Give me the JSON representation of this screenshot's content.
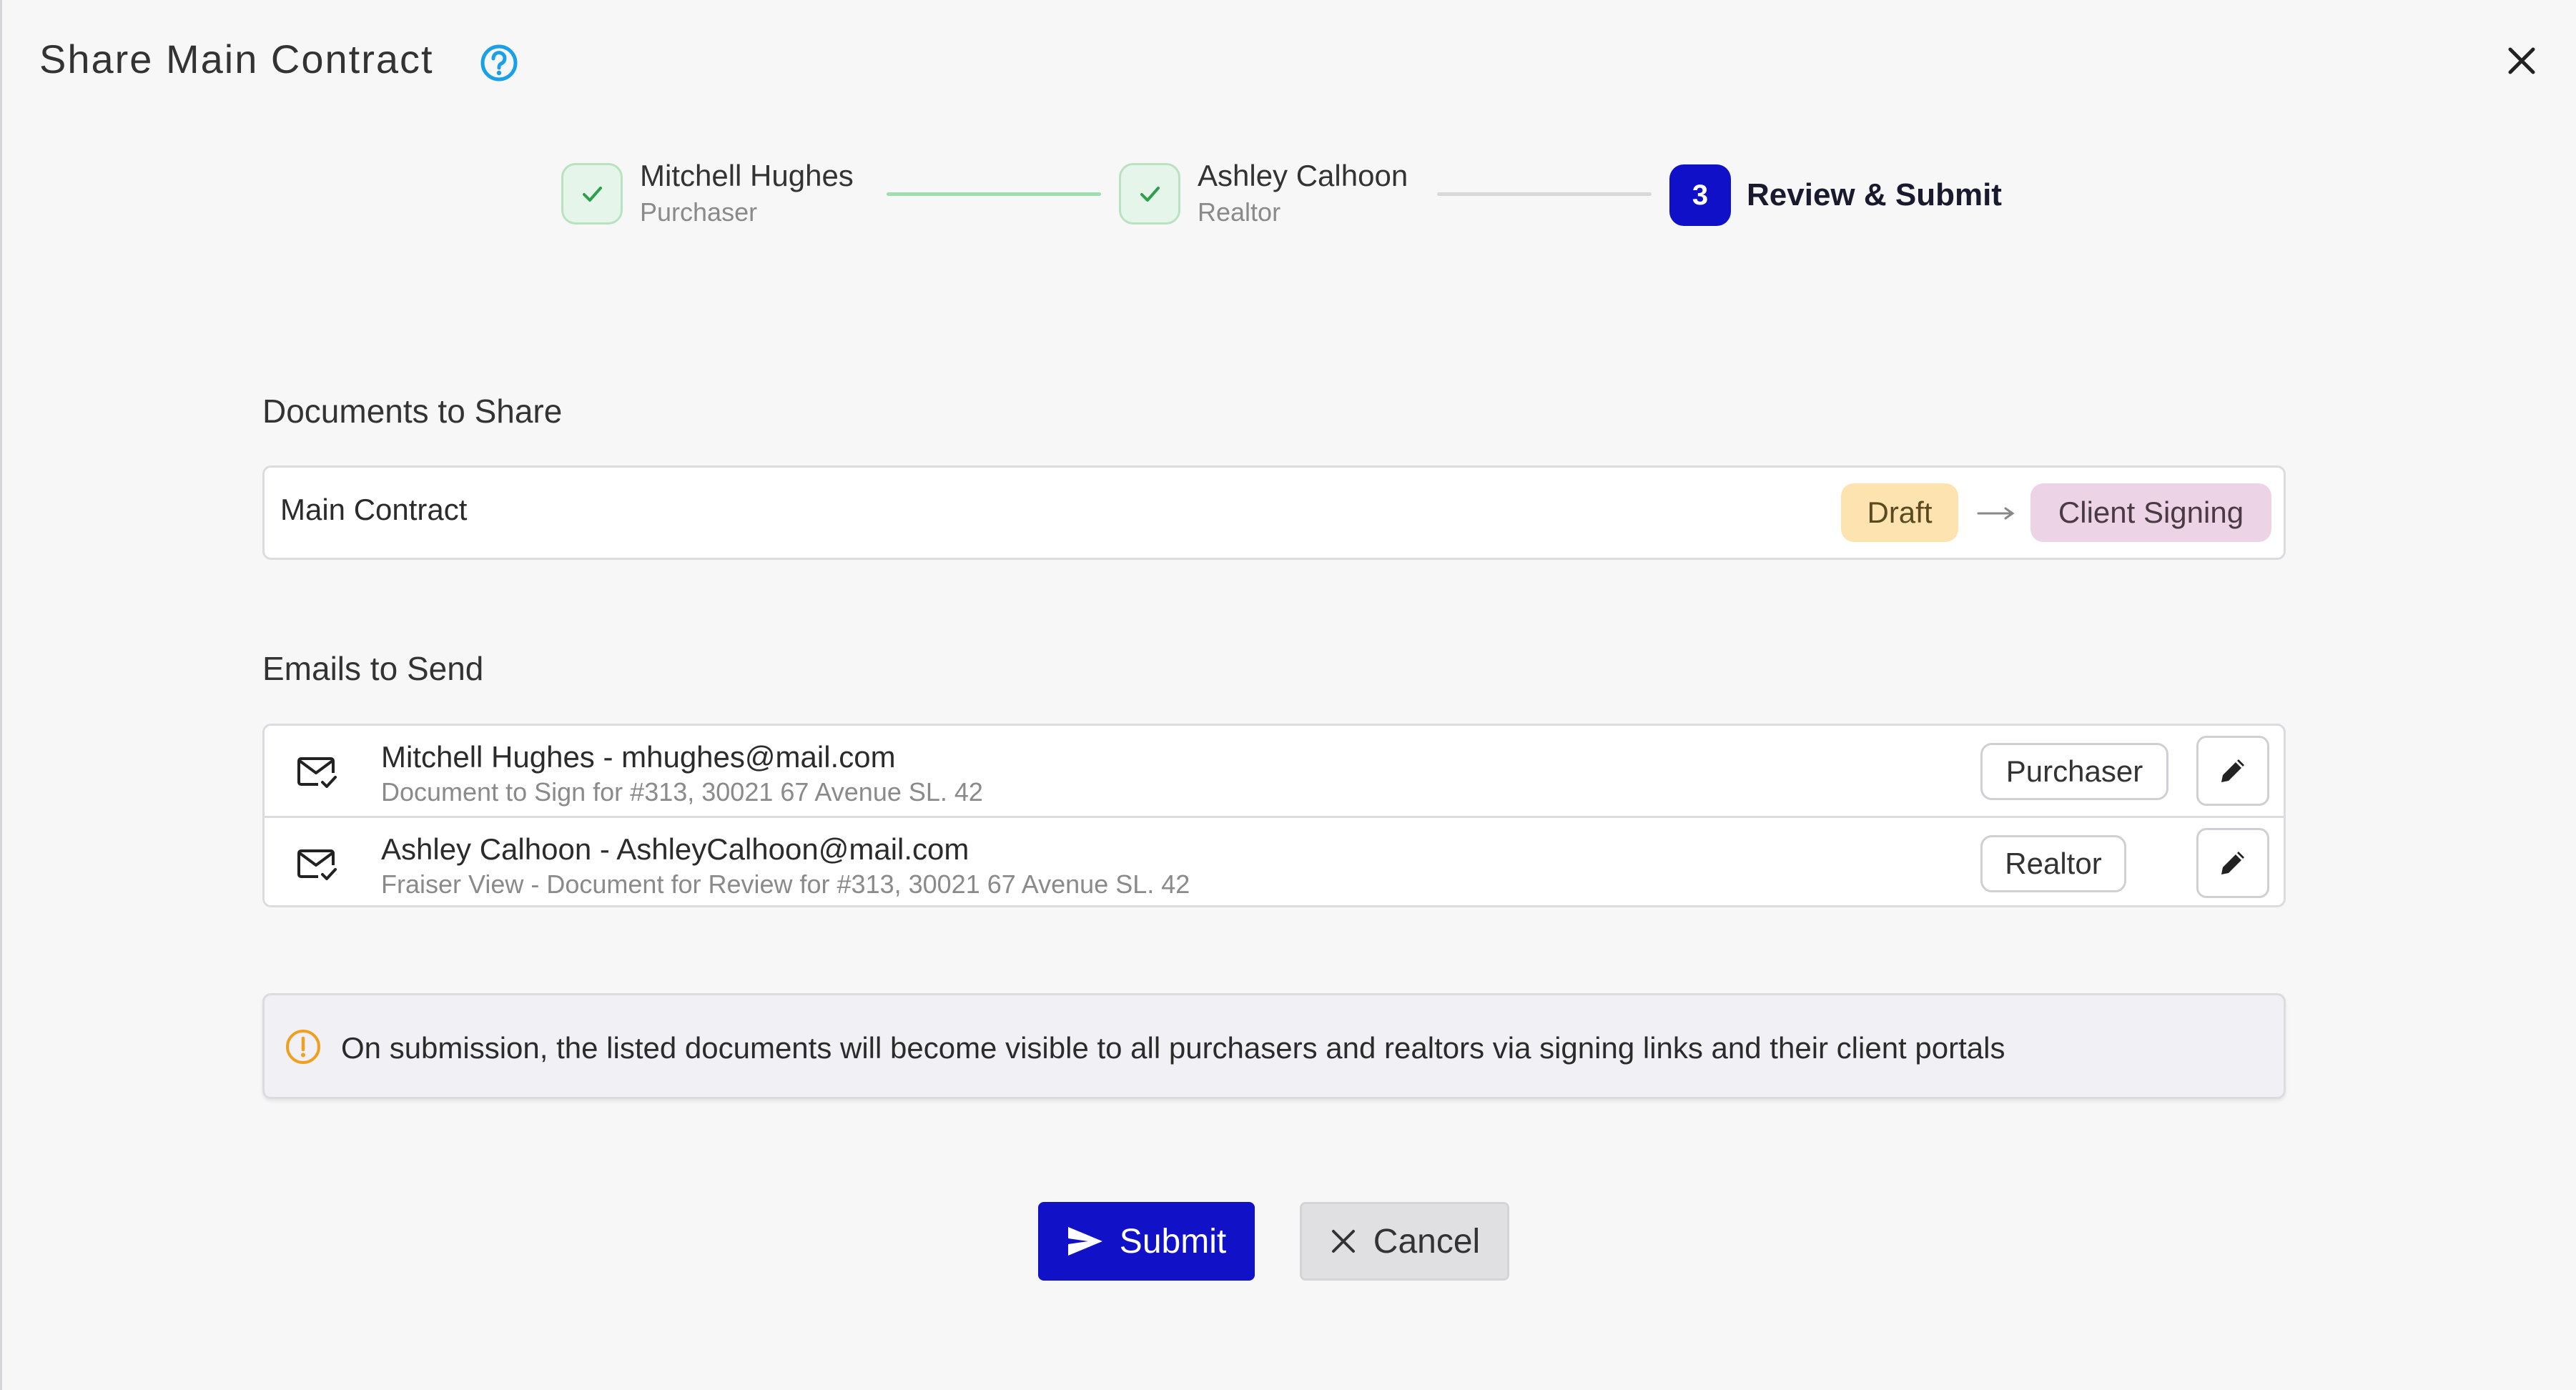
{
  "dialog": {
    "title": "Share Main Contract"
  },
  "stepper": {
    "steps": [
      {
        "name": "Mitchell Hughes",
        "role": "Purchaser",
        "state": "complete"
      },
      {
        "name": "Ashley Calhoon",
        "role": "Realtor",
        "state": "complete"
      },
      {
        "number": "3",
        "name": "Review & Submit",
        "state": "current"
      }
    ]
  },
  "documents": {
    "label": "Documents to Share",
    "items": [
      {
        "name": "Main Contract",
        "from_status": "Draft",
        "to_status": "Client Signing"
      }
    ]
  },
  "emails": {
    "label": "Emails to Send",
    "items": [
      {
        "recipient": "Mitchell Hughes - mhughes@mail.com",
        "subject": "Document to Sign for #313, 30021 67 Avenue SL. 42",
        "role": "Purchaser"
      },
      {
        "recipient": "Ashley Calhoon - AshleyCalhoon@mail.com",
        "subject": "Fraiser View - Document for Review for #313, 30021 67 Avenue SL. 42",
        "role": "Realtor"
      }
    ]
  },
  "notice": {
    "text": "On submission, the listed documents will become visible to all purchasers and realtors via signing links and their client portals"
  },
  "actions": {
    "submit_label": "Submit",
    "cancel_label": "Cancel"
  },
  "colors": {
    "primary": "#1111c7",
    "help_icon": "#1aa0e6",
    "step_complete_bg": "#e6f5e9",
    "step_complete_check": "#2e9e4f",
    "draft_bg": "#fde3b0",
    "client_signing_bg": "#ecd3e6",
    "warning": "#f0a020"
  },
  "icons": {
    "help": "help-circle-icon",
    "close": "close-icon",
    "check": "check-icon",
    "mail": "mail-check-icon",
    "edit": "pencil-icon",
    "warning": "alert-circle-icon",
    "submit": "send-icon",
    "cancel": "x-icon"
  }
}
